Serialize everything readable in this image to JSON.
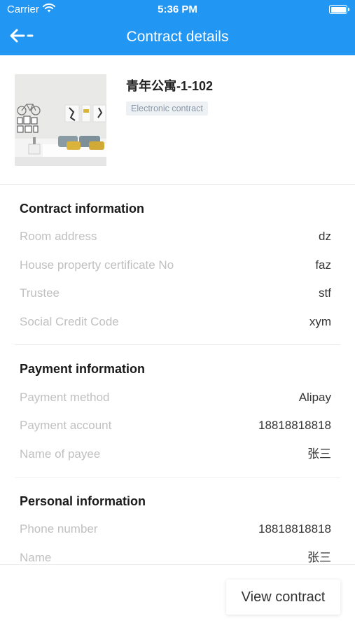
{
  "status_bar": {
    "carrier": "Carrier",
    "time": "5:36 PM"
  },
  "nav": {
    "title": "Contract details"
  },
  "property": {
    "name": "青年公寓-1-102",
    "tag": "Electronic contract"
  },
  "contract_info": {
    "title": "Contract information",
    "rows": [
      {
        "label": "Room address",
        "value": "dz"
      },
      {
        "label": "House property certificate No",
        "value": "faz"
      },
      {
        "label": "Trustee",
        "value": "stf"
      },
      {
        "label": "Social Credit Code",
        "value": "xym"
      }
    ]
  },
  "payment_info": {
    "title": "Payment information",
    "rows": [
      {
        "label": "Payment method",
        "value": "Alipay"
      },
      {
        "label": "Payment account",
        "value": "18818818818"
      },
      {
        "label": "Name of payee",
        "value": "张三"
      }
    ]
  },
  "personal_info": {
    "title": "Personal information",
    "rows": [
      {
        "label": "Phone number",
        "value": "18818818818"
      },
      {
        "label": "Name",
        "value": "张三"
      }
    ]
  },
  "footer": {
    "view_contract_label": "View contract"
  },
  "colors": {
    "accent": "#2196f3",
    "label_gray": "#c0c0c0",
    "tag_bg": "#eef1f4"
  }
}
